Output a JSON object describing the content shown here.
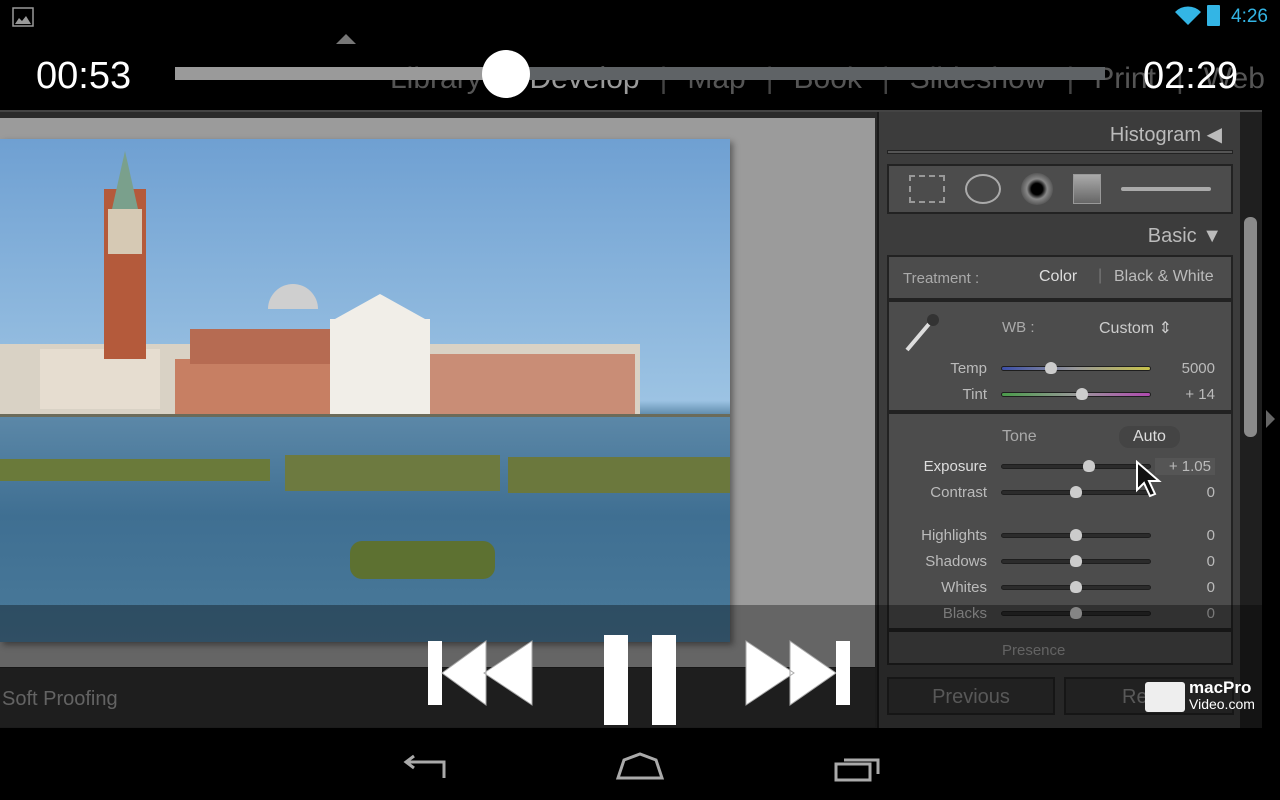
{
  "status_bar": {
    "notification_icon": "image-icon",
    "wifi_icon": "wifi-icon",
    "battery_icon": "battery-icon",
    "time": "4:26",
    "accent": "#33b5e5"
  },
  "video": {
    "current_time": "00:53",
    "total_time": "02:29",
    "progress": 0.356,
    "controls": {
      "previous": "skip-previous-icon",
      "pause": "pause-icon",
      "next": "skip-next-icon"
    }
  },
  "lightroom": {
    "modules": [
      "Library",
      "Develop",
      "Map",
      "Book",
      "Slideshow",
      "Print",
      "Web"
    ],
    "active_module": "Develop",
    "toolbar": {
      "soft_proofing": "Soft Proofing"
    },
    "panel": {
      "histogram": "Histogram",
      "tools": [
        "crop-overlay-icon",
        "spot-removal-icon",
        "red-eye-icon",
        "graduated-filter-icon",
        "adjustment-brush-icon"
      ],
      "basic": "Basic",
      "treatment_label": "Treatment :",
      "treatment_color": "Color",
      "treatment_bw": "Black & White",
      "wb_label": "WB :",
      "wb_value": "Custom",
      "tone_label": "Tone",
      "auto_label": "Auto",
      "sliders": [
        {
          "label": "Temp",
          "value": "5000",
          "position": 0.33
        },
        {
          "label": "Tint",
          "value": "+ 14",
          "position": 0.54
        },
        {
          "label": "Exposure",
          "value": "+ 1.05",
          "position": 0.59
        },
        {
          "label": "Contrast",
          "value": "0",
          "position": 0.5
        },
        {
          "label": "Highlights",
          "value": "0",
          "position": 0.5
        },
        {
          "label": "Shadows",
          "value": "0",
          "position": 0.5
        },
        {
          "label": "Whites",
          "value": "0",
          "position": 0.5
        },
        {
          "label": "Blacks",
          "value": "0",
          "position": 0.5
        }
      ],
      "presence": "Presence",
      "previous_button": "Previous",
      "reset_button": "Re"
    }
  },
  "watermark": {
    "line1": "macPro",
    "line2": "Video.com"
  },
  "navigation": {
    "back": "back-icon",
    "home": "home-icon",
    "recents": "recents-icon"
  }
}
